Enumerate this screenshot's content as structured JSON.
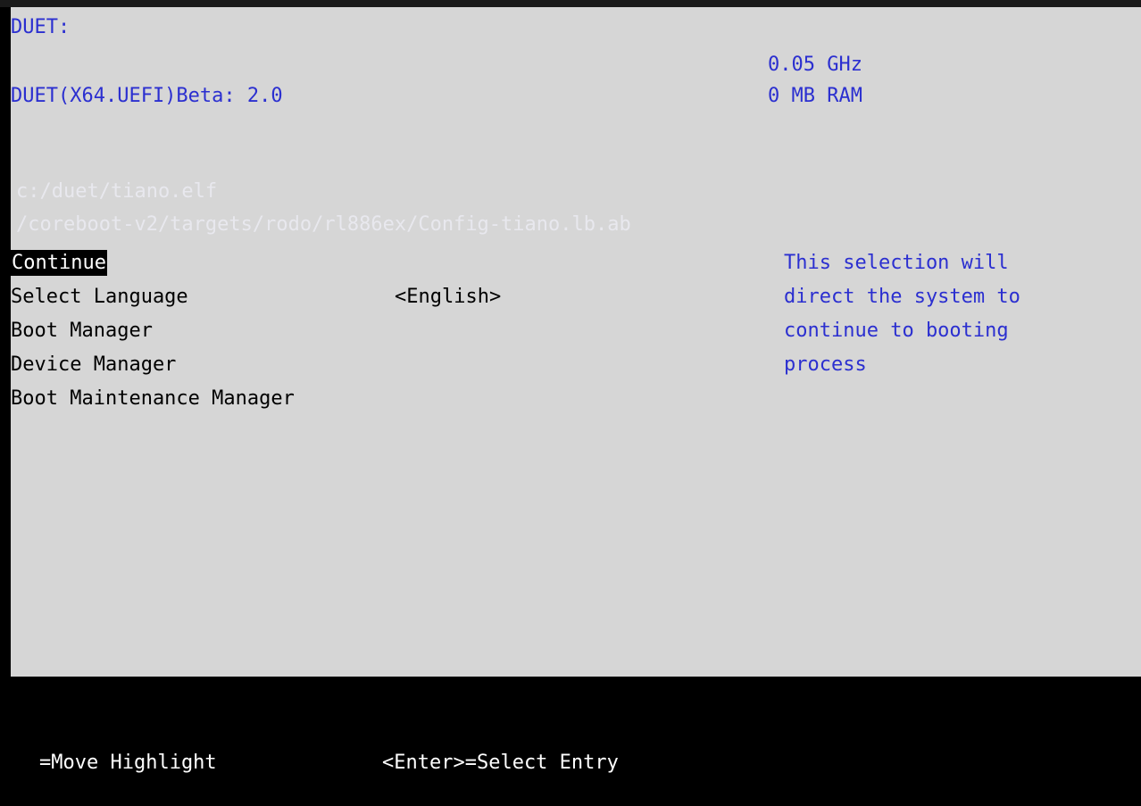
{
  "header": {
    "firmware_label": "DUET:",
    "firmware_version": "DUET(X64.UEFI)Beta: 2.0",
    "cpu_speed": "0.05 GHz",
    "ram": "0 MB RAM"
  },
  "boot_paths": {
    "line1": "c:/duet/tiano.elf",
    "line2": "/coreboot-v2/targets/rodo/rl886ex/Config-tiano.lb.ab"
  },
  "menu": {
    "items": [
      {
        "label": "Continue",
        "selected": true
      },
      {
        "label": "Select Language"
      },
      {
        "label": "Boot Manager"
      },
      {
        "label": "Device Manager"
      },
      {
        "label": "Boot Maintenance Manager"
      }
    ],
    "language_value": "<English>"
  },
  "help": {
    "lines": [
      "This selection will",
      "direct the system to",
      "continue to booting",
      "process"
    ]
  },
  "footer": {
    "move_hint": "=Move Highlight",
    "select_hint": "<Enter>=Select Entry"
  },
  "colors": {
    "panel_background": "#d6d6d6",
    "info_text": "#2b2fd0",
    "menu_text": "#000000",
    "footer_background": "#000000",
    "footer_text": "#ffffff",
    "highlight_background": "#000000",
    "highlight_text": "#ffffff"
  }
}
